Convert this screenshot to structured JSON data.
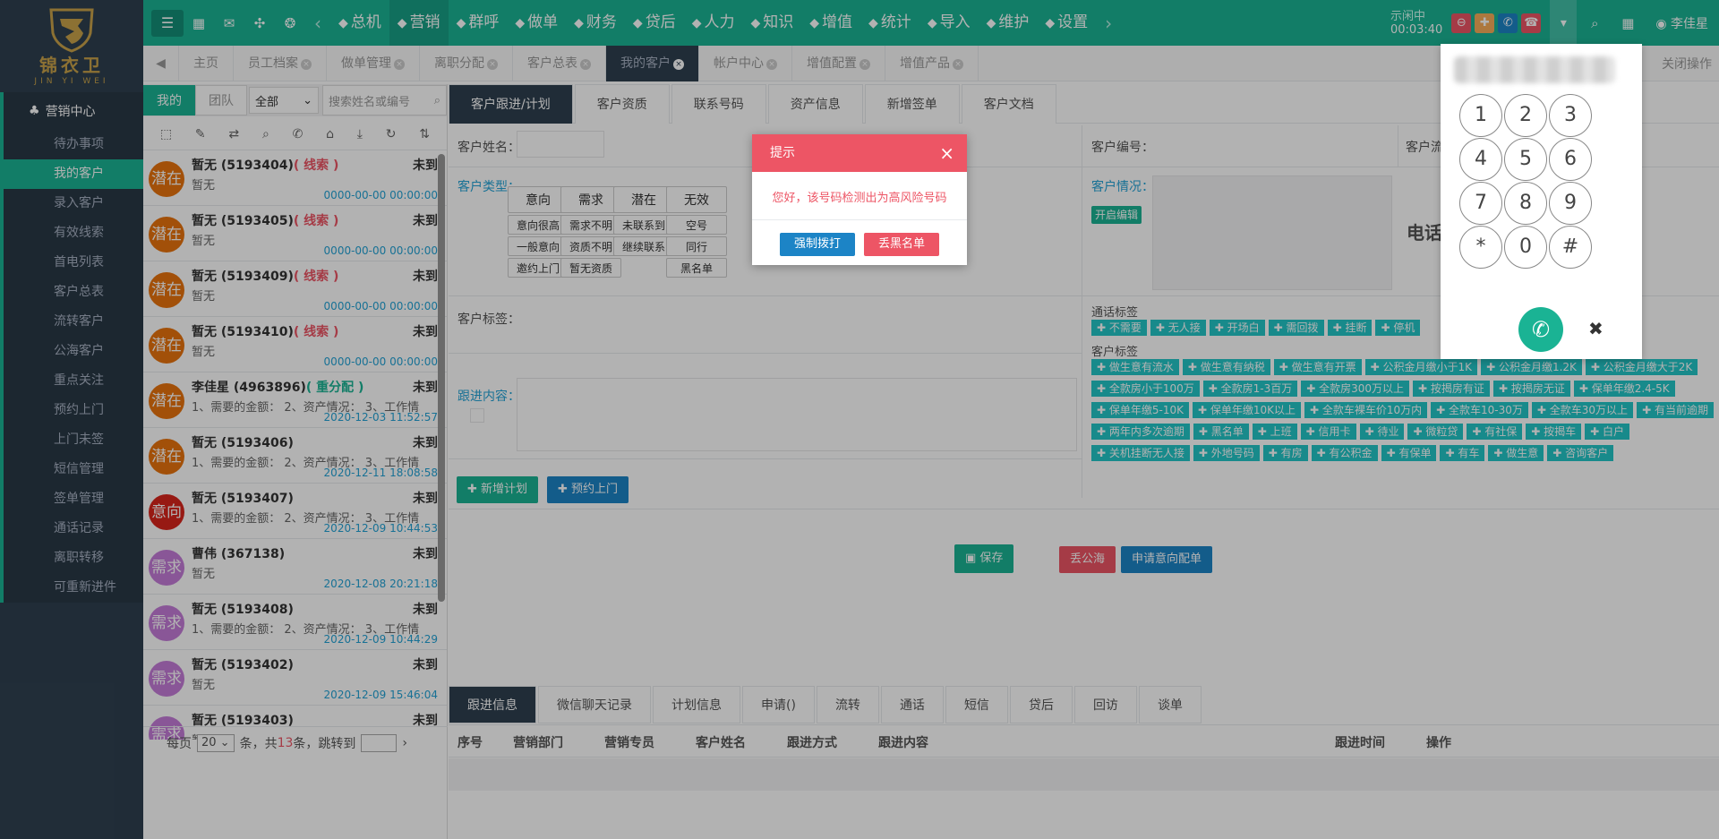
{
  "logo": {
    "name": "锦衣卫",
    "sub": "JIN YI WEI"
  },
  "sidebar": {
    "section": "营销中心",
    "items": [
      {
        "label": "待办事项",
        "active": false
      },
      {
        "label": "我的客户",
        "active": true
      },
      {
        "label": "录入客户",
        "active": false
      },
      {
        "label": "有效线索",
        "active": false
      },
      {
        "label": "首电列表",
        "active": false
      },
      {
        "label": "客户总表",
        "active": false
      },
      {
        "label": "流转客户",
        "active": false
      },
      {
        "label": "公海客户",
        "active": false
      },
      {
        "label": "重点关注",
        "active": false
      },
      {
        "label": "预约上门",
        "active": false
      },
      {
        "label": "上门未签",
        "active": false
      },
      {
        "label": "短信管理",
        "active": false
      },
      {
        "label": "签单管理",
        "active": false
      },
      {
        "label": "通话记录",
        "active": false
      },
      {
        "label": "离职转移",
        "active": false
      },
      {
        "label": "可重新进件",
        "active": false
      }
    ]
  },
  "topnav": {
    "menus": [
      "总机",
      "营销",
      "群呼",
      "做单",
      "财务",
      "贷后",
      "人力",
      "知识",
      "增值",
      "统计",
      "导入",
      "维护",
      "设置"
    ],
    "menu_icons": [
      "phone-icon",
      "users-icon",
      "wifi-icon",
      "sitemap-icon",
      "yen-icon",
      "user-plus-icon",
      "id-card-icon",
      "book-icon",
      "list-icon",
      "bar-chart-icon",
      "download-icon",
      "database-icon",
      "gear-icon"
    ],
    "active_menu": "营销",
    "status_label": "示闲中",
    "status_time": "00:03:40",
    "user": "李佳星"
  },
  "tabs": {
    "items": [
      "主页",
      "员工档案",
      "做单管理",
      "离职分配",
      "客户总表",
      "我的客户",
      "帐户中心",
      "增值配置",
      "增值产品"
    ],
    "active": "我的客户",
    "close_ops": "关闭操作"
  },
  "left_panel": {
    "seg_mine": "我的",
    "seg_team": "团队",
    "filter": "全部",
    "search_placeholder": "搜索姓名或编号",
    "customers": [
      {
        "badge": "潜在",
        "badge_color": "#e8730e",
        "name": "暂无 (5193404)",
        "tag": "( 线索 )",
        "tag_color": "red",
        "status": "未到",
        "desc": "暂无",
        "time": "0000-00-00 00:00:00"
      },
      {
        "badge": "潜在",
        "badge_color": "#e8730e",
        "name": "暂无 (5193405)",
        "tag": "( 线索 )",
        "tag_color": "red",
        "status": "未到",
        "desc": "暂无",
        "time": "0000-00-00 00:00:00"
      },
      {
        "badge": "潜在",
        "badge_color": "#e8730e",
        "name": "暂无 (5193409)",
        "tag": "( 线索 )",
        "tag_color": "red",
        "status": "未到",
        "desc": "暂无",
        "time": "0000-00-00 00:00:00"
      },
      {
        "badge": "潜在",
        "badge_color": "#e8730e",
        "name": "暂无 (5193410)",
        "tag": "( 线索 )",
        "tag_color": "red",
        "status": "未到",
        "desc": "暂无",
        "time": "0000-00-00 00:00:00"
      },
      {
        "badge": "潜在",
        "badge_color": "#e8730e",
        "name": "李佳星 (4963896)",
        "tag": "( 重分配 )",
        "tag_color": "green",
        "status": "未到",
        "desc": "1、需要的金额： 2、资产情况： 3、工作情况",
        "time": "2020-12-03 11:52:57"
      },
      {
        "badge": "潜在",
        "badge_color": "#e8730e",
        "name": "暂无 (5193406)",
        "tag": "",
        "tag_color": "red",
        "status": "未到",
        "desc": "1、需要的金额： 2、资产情况： 3、工作情况",
        "time": "2020-12-11 18:08:58"
      },
      {
        "badge": "意向",
        "badge_color": "#d9251c",
        "name": "暂无 (5193407)",
        "tag": "",
        "tag_color": "red",
        "status": "未到",
        "desc": "1、需要的金额： 2、资产情况： 3、工作情况",
        "time": "2020-12-09 10:44:53"
      },
      {
        "badge": "需求",
        "badge_color": "#c47bd8",
        "name": "曹伟 (367138)",
        "tag": "",
        "tag_color": "red",
        "status": "未到",
        "desc": "暂无",
        "time": "2020-12-08 20:21:18"
      },
      {
        "badge": "需求",
        "badge_color": "#c47bd8",
        "name": "暂无 (5193408)",
        "tag": "",
        "tag_color": "red",
        "status": "未到",
        "desc": "1、需要的金额： 2、资产情况： 3、工作情况",
        "time": "2020-12-09 10:44:29"
      },
      {
        "badge": "需求",
        "badge_color": "#c47bd8",
        "name": "暂无 (5193402)",
        "tag": "",
        "tag_color": "red",
        "status": "未到",
        "desc": "暂无",
        "time": "2020-12-09 15:46:04"
      },
      {
        "badge": "需求",
        "badge_color": "#c47bd8",
        "name": "暂无 (5193403)",
        "tag": "",
        "tag_color": "red",
        "status": "未到",
        "desc": "暂无",
        "time": ""
      }
    ],
    "pager": {
      "per_page_label": "每页",
      "per_page": "20",
      "mid": "条，共",
      "total": "13",
      "tail": "条，跳转到"
    }
  },
  "main": {
    "tabs": [
      "客户跟进/计划",
      "客户资质",
      "联系号码",
      "资产信息",
      "新增签单",
      "客户文档"
    ],
    "active_tab": "客户跟进/计划",
    "labels": {
      "name": "客户姓名：",
      "number": "客户编号：",
      "source": "客户流",
      "type": "客户类型：",
      "situation": "客户情况：",
      "edit": "开启编辑",
      "phone_partial": "电话",
      "tags": "客户标签：",
      "call_tags": "通话标签",
      "cust_tags": "客户标签",
      "content": "跟进内容："
    },
    "type_grid": [
      [
        "意向",
        "需求",
        "潜在",
        "无效"
      ],
      [
        "意向很高",
        "需求不明",
        "未联系到",
        "空号"
      ],
      [
        "一般意向",
        "资质不明",
        "继续联系",
        "同行"
      ],
      [
        "邀约上门",
        "暂无资质",
        "",
        "黑名单"
      ]
    ],
    "call_tags": [
      "不需要",
      "无人接",
      "开场白",
      "需回拨",
      "挂断",
      "停机"
    ],
    "customer_tags": [
      "做生意有流水",
      "做生意有纳税",
      "做生意有开票",
      "公积金月缴小于1K",
      "公积金月缴1.2K",
      "公积金月缴大于2K",
      "全款房小于100万",
      "全款房1-3百万",
      "全款房300万以上",
      "按揭房有证",
      "按揭房无证",
      "保单年缴2.4-5K",
      "保单年缴5-10K",
      "保单年缴10K以上",
      "全款车裸车价10万内",
      "全款车10-30万",
      "全款车30万以上",
      "有当前逾期",
      "两年内多次逾期",
      "黑名单",
      "上班",
      "信用卡",
      "待业",
      "微粒贷",
      "有社保",
      "按揭车",
      "白户",
      "关机挂断无人接",
      "外地号码",
      "有房",
      "有公积金",
      "有保单",
      "有车",
      "做生意",
      "咨询客户"
    ],
    "buttons": {
      "new_plan": "新增计划",
      "appointment": "预约上门",
      "save": "保存",
      "to_pool": "丢公海",
      "apply": "申请意向配单"
    },
    "bottom_tabs": [
      "跟进信息",
      "微信聊天记录",
      "计划信息",
      "申请()",
      "流转",
      "通话",
      "短信",
      "贷后",
      "回访",
      "谈单"
    ],
    "active_bottom_tab": "跟进信息",
    "table_headers": [
      "序号",
      "营销部门",
      "营销专员",
      "客户姓名",
      "跟进方式",
      "跟进内容",
      "跟进时间",
      "操作"
    ]
  },
  "dialog": {
    "title": "提示",
    "message": "您好，该号码检测出为高风险号码",
    "force_call": "强制拨打",
    "blacklist": "丢黑名单"
  },
  "dialpad": {
    "keys": [
      "1",
      "2",
      "3",
      "4",
      "5",
      "6",
      "7",
      "8",
      "9",
      "*",
      "0",
      "#"
    ]
  },
  "colors": {
    "primary": "#1ab394",
    "sidebar": "#2f4050",
    "danger": "#ed5565",
    "info": "#1c84c6",
    "tag": "#23c6c8"
  }
}
